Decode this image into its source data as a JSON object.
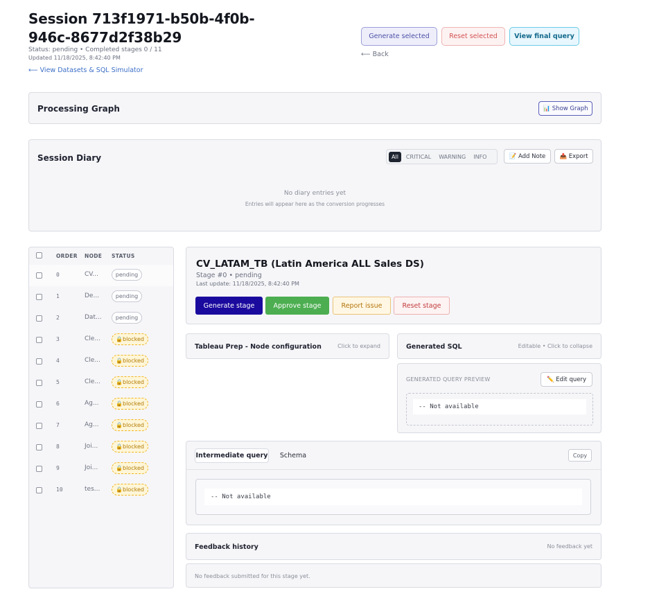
{
  "header": {
    "title": "Session 713f1971-b50b-4f0b-946c-8677d2f38b29",
    "status_line": "Status: pending • Completed stages 0 / 11",
    "updated_line": "Updated 11/18/2025, 8:42:40 PM",
    "datasets_link": "⟵ View Datasets & SQL Simulator",
    "generate_selected": "Generate selected",
    "reset_selected": "Reset selected",
    "view_final_query": "View final query",
    "back_link": "⟵ Back"
  },
  "processing_graph": {
    "title": "Processing Graph",
    "show_graph": "📊 Show Graph"
  },
  "diary": {
    "title": "Session Diary",
    "filters": [
      "All",
      "CRITICAL",
      "WARNING",
      "INFO"
    ],
    "active_filter": "All",
    "add_note": "📝 Add Note",
    "export": "📤 Export",
    "empty_title": "No diary entries yet",
    "empty_sub": "Entries will appear here as the conversion progresses"
  },
  "stage_table": {
    "headers": {
      "order": "ORDER",
      "node": "NODE",
      "status": "STATUS"
    },
    "rows": [
      {
        "order": "0",
        "node": "CV...",
        "status": "pending",
        "kind": "pending"
      },
      {
        "order": "1",
        "node": "De...",
        "status": "pending",
        "kind": "pending"
      },
      {
        "order": "2",
        "node": "Dat...",
        "status": "pending",
        "kind": "pending"
      },
      {
        "order": "3",
        "node": "Cle...",
        "status": "🔒blocked",
        "kind": "blocked"
      },
      {
        "order": "4",
        "node": "Cle...",
        "status": "🔒blocked",
        "kind": "blocked"
      },
      {
        "order": "5",
        "node": "Cle...",
        "status": "🔒blocked",
        "kind": "blocked"
      },
      {
        "order": "6",
        "node": "Ag...",
        "status": "🔒blocked",
        "kind": "blocked"
      },
      {
        "order": "7",
        "node": "Ag...",
        "status": "🔒blocked",
        "kind": "blocked"
      },
      {
        "order": "8",
        "node": "Joi...",
        "status": "🔒blocked",
        "kind": "blocked"
      },
      {
        "order": "9",
        "node": "Joi...",
        "status": "🔒blocked",
        "kind": "blocked"
      },
      {
        "order": "10",
        "node": "tes...",
        "status": "🔒blocked",
        "kind": "blocked"
      }
    ]
  },
  "stage": {
    "title": "CV_LATAM_TB (Latin America ALL Sales DS)",
    "subtitle": "Stage #0 • pending",
    "last_update": "Last update: 11/18/2025, 8:42:40 PM",
    "generate": "Generate stage",
    "approve": "Approve stage",
    "report": "Report issue",
    "reset": "Reset stage"
  },
  "node_config": {
    "title": "Tableau Prep - Node configuration",
    "hint": "Click to expand"
  },
  "generated_sql": {
    "title": "Generated SQL",
    "hint": "Editable  •  Click to collapse",
    "preview_label": "GENERATED QUERY PREVIEW",
    "edit_query": "✏️  Edit query",
    "code": "-- Not available"
  },
  "intermediate": {
    "tab_active": "Intermediate query",
    "tab_schema": "Schema",
    "copy": "Copy",
    "code": "-- Not available"
  },
  "feedback": {
    "title": "Feedback history",
    "hint": "No feedback yet",
    "empty": "No feedback submitted for this stage yet."
  }
}
